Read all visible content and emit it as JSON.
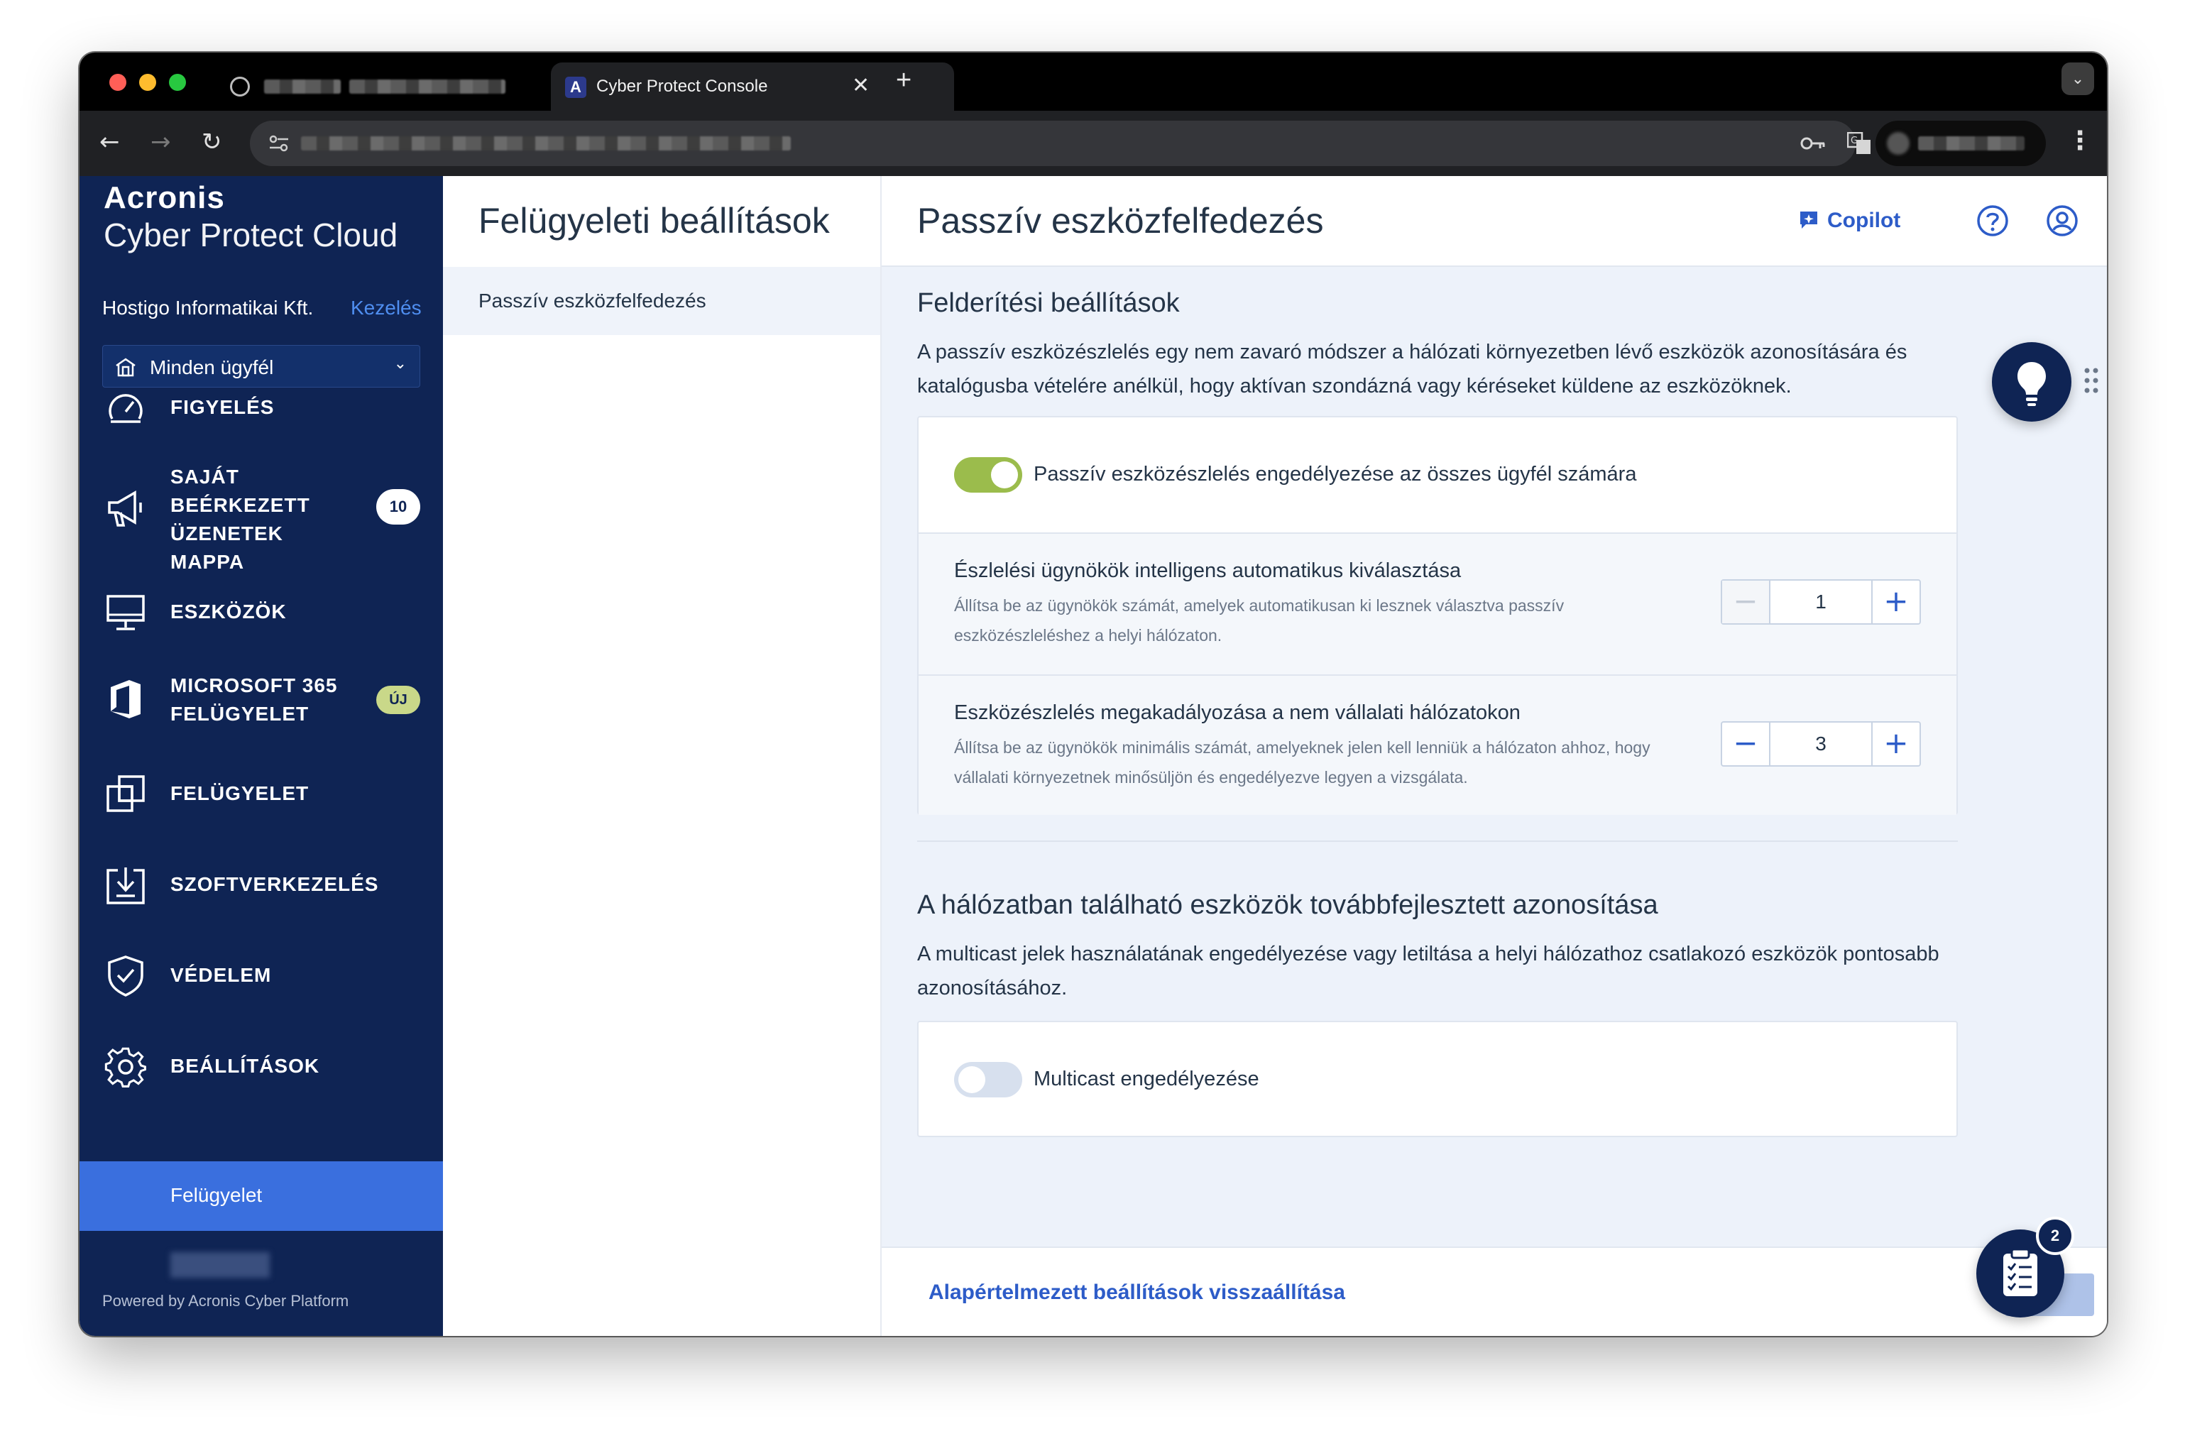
{
  "browser": {
    "active_tab_title": "Cyber Protect Console",
    "tab_favicon_letter": "A",
    "new_tab_symbol": "+",
    "colors": {
      "chrome_bg": "#000000",
      "toolbar_bg": "#202124"
    }
  },
  "sidebar": {
    "logo_line1": "Acronis",
    "logo_line2": "Cyber Protect Cloud",
    "org_name": "Hostigo Informatikai Kft.",
    "org_manage_link": "Kezelés",
    "customer_select": "Minden ügyfél",
    "items": [
      {
        "label": "FIGYELÉS",
        "icon": "monitoring-gauge-icon"
      },
      {
        "label": "SAJÁT BEÉRKEZETT ÜZENETEK MAPPA",
        "icon": "megaphone-icon",
        "badge": "10"
      },
      {
        "label": "ESZKÖZÖK",
        "icon": "monitor-icon"
      },
      {
        "label": "MICROSOFT 365 FELÜGYELET",
        "icon": "office365-icon",
        "badge": "ÚJ"
      },
      {
        "label": "FELÜGYELET",
        "icon": "management-squares-icon"
      },
      {
        "label": "SZOFTVERKEZELÉS",
        "icon": "software-download-icon"
      },
      {
        "label": "VÉDELEM",
        "icon": "shield-check-icon"
      },
      {
        "label": "BEÁLLÍTÁSOK",
        "icon": "gear-icon"
      }
    ],
    "active_subitem": "Felügyelet",
    "powered_by": "Powered by Acronis Cyber Platform",
    "colors": {
      "background": "#0f2454",
      "active": "#3a6fde"
    }
  },
  "midpanel": {
    "title": "Felügyeleti beállítások",
    "items": [
      "Passzív eszközfelfedezés"
    ]
  },
  "main": {
    "title": "Passzív eszközfelfedezés",
    "copilot_label": "Copilot",
    "discovery": {
      "title": "Felderítési beállítások",
      "description": "A passzív eszközészlelés egy nem zavaró módszer a hálózati környezetben lévő eszközök azonosítására és katalógusba vételére anélkül, hogy aktívan szondázná vagy kéréseket küldene az eszközöknek.",
      "toggle_label": "Passzív eszközészlelés engedélyezése az összes ügyfél számára",
      "toggle_on": true,
      "settings": [
        {
          "title": "Észlelési ügynökök intelligens automatikus kiválasztása",
          "help": "Állítsa be az ügynökök számát, amelyek automatikusan ki lesznek választva passzív eszközészleléshez a helyi hálózaton.",
          "value": "1",
          "minus_disabled": true
        },
        {
          "title": "Eszközészlelés megakadályozása a nem vállalati hálózatokon",
          "help": "Állítsa be az ügynökök minimális számát, amelyeknek jelen kell lenniük a hálózaton ahhoz, hogy vállalati környezetnek minősüljön és engedélyezve legyen a vizsgálata.",
          "value": "3",
          "minus_disabled": false
        }
      ]
    },
    "advanced": {
      "title": "A hálózatban található eszközök továbbfejlesztett azonosítása",
      "description": "A multicast jelek használatának engedélyezése vagy letiltása a helyi hálózathoz csatlakozó eszközök pontosabb azonosításához.",
      "toggle_label": "Multicast engedélyezése",
      "toggle_on": false
    },
    "reset_link": "Alapértelmezett beállítások visszaállítása",
    "tasks_badge": "2",
    "colors": {
      "accent": "#2d5cc8",
      "toggle_on": "#9bbc4c",
      "toggle_off": "#d7e0ee"
    }
  }
}
